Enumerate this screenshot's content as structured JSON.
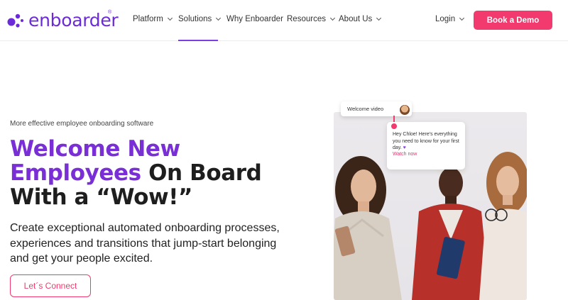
{
  "header": {
    "logo_text": "enboarder",
    "logo_mark": "®",
    "nav": [
      {
        "label": "Platform"
      },
      {
        "label": "Solutions"
      },
      {
        "label": "Why Enboarder"
      },
      {
        "label": "Resources"
      },
      {
        "label": "About Us"
      }
    ],
    "login_label": "Login",
    "demo_label": "Book a Demo"
  },
  "hero": {
    "eyebrow": "More effective employee onboarding software",
    "headline_accent_1": "Welcome New",
    "headline_accent_2": "Employees",
    "headline_rest_1": " On Board",
    "headline_rest_2": "With a “Wow!”",
    "subtext": "Create exceptional automated onboarding processes, experiences and transitions that jump-start belonging and get your people excited.",
    "cta_label": "Let´s Connect"
  },
  "image_card": {
    "welcome_label": "Welcome video",
    "message": "Hey Chloe! Here's everything you need to know for your first day.",
    "heart": "♥",
    "link": "Watch now"
  },
  "colors": {
    "brand_purple": "#6c2bd9",
    "accent_pink": "#f23a6e",
    "headline_purple": "#7a2fd6"
  },
  "icons": [
    "logo-dots-icon",
    "chevron-down-icon",
    "heart-icon"
  ]
}
